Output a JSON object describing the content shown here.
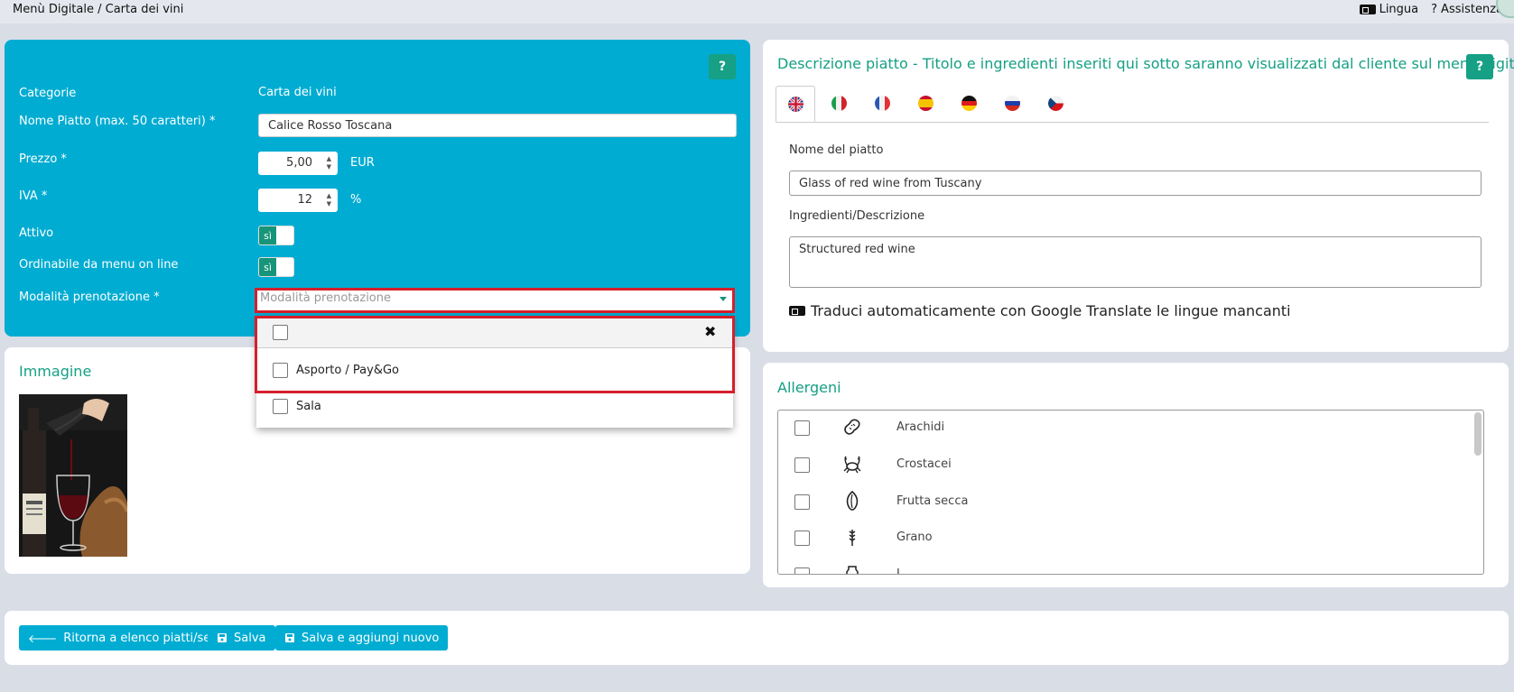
{
  "topbar": {
    "breadcrumb": "Menù Digitale / Carta dei vini",
    "lingua": "Lingua",
    "assistenza": "Assistenza",
    "help_glyph": "?"
  },
  "form": {
    "help": "?",
    "categorie_label": "Categorie",
    "categorie_value": "Carta dei vini",
    "nome_label": "Nome Piatto (max. 50 caratteri)  *",
    "nome_value": "Calice Rosso Toscana",
    "prezzo_label": "Prezzo  *",
    "prezzo_value": "5,00",
    "prezzo_unit": "EUR",
    "iva_label": "IVA  *",
    "iva_value": "12",
    "iva_unit": "%",
    "attivo_label": "Attivo",
    "attivo_toggle": "sì",
    "ordinabile_label": "Ordinabile da menu on line",
    "ordinabile_toggle": "sì",
    "modalita_label": "Modalità prenotazione  *",
    "modalita_placeholder": "Modalità prenotazione"
  },
  "dropdown": {
    "close_glyph": "✖",
    "options": [
      "Asporto / Pay&Go",
      "Sala"
    ]
  },
  "immagine": {
    "title": "Immagine"
  },
  "descrizione": {
    "title": "Descrizione piatto - Titolo e ingredienti inseriti qui sotto saranno visualizzati dal cliente sul menù digitale",
    "help": "?",
    "nome_label": "Nome del piatto",
    "nome_value": "Glass of red wine from Tuscany",
    "ingredienti_label": "Ingredienti/Descrizione",
    "ingredienti_value": "Structured red wine",
    "translate_text": "Traduci automaticamente con Google Translate le lingue mancanti"
  },
  "allergeni": {
    "title": "Allergeni",
    "items": [
      "Arachidi",
      "Crostacei",
      "Frutta secca",
      "Grano",
      "L..."
    ]
  },
  "actions": {
    "back": "Ritorna a elenco piatti/servizi",
    "save": "Salva",
    "save_new": "Salva e aggiungi nuovo"
  }
}
